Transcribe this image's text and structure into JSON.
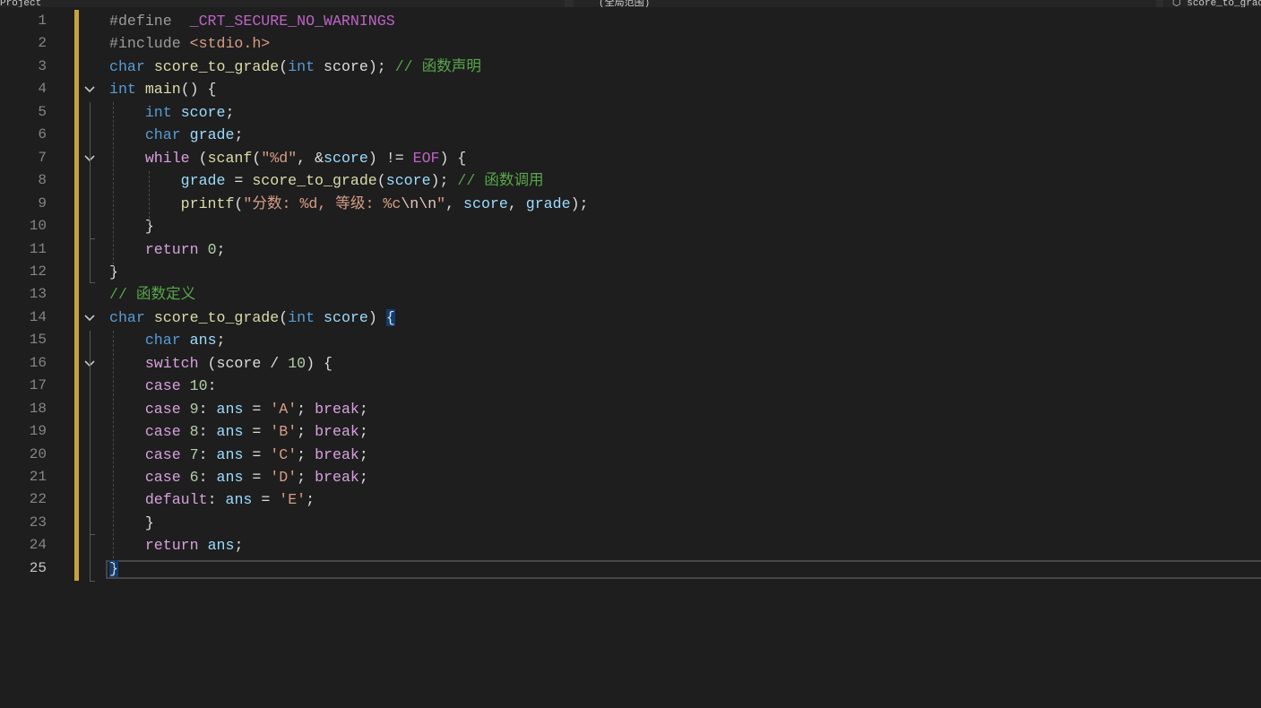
{
  "tabs": {
    "left": "Project",
    "middle": "(全局范围)",
    "right": "score_to_grade"
  },
  "colors": {
    "background": "#1e1e1e",
    "keyword": "#569cd6",
    "control": "#d8a0df",
    "function": "#dcdcaa",
    "variable": "#9cdcfe",
    "string": "#d69d85",
    "number": "#b5cea8",
    "comment": "#57a64a",
    "macro": "#bd63c5",
    "change_marker": "#c8a43a"
  },
  "editor": {
    "current_line": 25,
    "lines": [
      {
        "n": "1",
        "t": [
          [
            "pp",
            "#define"
          ],
          [
            "plain",
            "  "
          ],
          [
            "mac",
            "_CRT_SECURE_NO_WARNINGS"
          ]
        ]
      },
      {
        "n": "2",
        "t": [
          [
            "pp",
            "#include "
          ],
          [
            "inc",
            "<stdio.h>"
          ]
        ]
      },
      {
        "n": "3",
        "t": [
          [
            "kw",
            "char"
          ],
          [
            "plain",
            " "
          ],
          [
            "fn",
            "score_to_grade"
          ],
          [
            "plain",
            "("
          ],
          [
            "kw",
            "int"
          ],
          [
            "plain",
            " score); "
          ],
          [
            "cm",
            "// 函数声明"
          ]
        ]
      },
      {
        "n": "4",
        "t": [
          [
            "kw",
            "int"
          ],
          [
            "plain",
            " "
          ],
          [
            "fn",
            "main"
          ],
          [
            "plain",
            "() {"
          ]
        ]
      },
      {
        "n": "5",
        "t": [
          [
            "plain",
            "    "
          ],
          [
            "kw",
            "int"
          ],
          [
            "plain",
            " "
          ],
          [
            "var",
            "score"
          ],
          [
            "plain",
            ";"
          ]
        ]
      },
      {
        "n": "6",
        "t": [
          [
            "plain",
            "    "
          ],
          [
            "kw",
            "char"
          ],
          [
            "plain",
            " "
          ],
          [
            "var",
            "grade"
          ],
          [
            "plain",
            ";"
          ]
        ]
      },
      {
        "n": "7",
        "t": [
          [
            "plain",
            "    "
          ],
          [
            "ctl",
            "while"
          ],
          [
            "plain",
            " ("
          ],
          [
            "fn",
            "scanf"
          ],
          [
            "plain",
            "("
          ],
          [
            "str",
            "\"%d\""
          ],
          [
            "plain",
            ", &"
          ],
          [
            "var",
            "score"
          ],
          [
            "plain",
            ") != "
          ],
          [
            "mac",
            "EOF"
          ],
          [
            "plain",
            ") {"
          ]
        ]
      },
      {
        "n": "8",
        "t": [
          [
            "plain",
            "        "
          ],
          [
            "var",
            "grade"
          ],
          [
            "plain",
            " = "
          ],
          [
            "fn",
            "score_to_grade"
          ],
          [
            "plain",
            "("
          ],
          [
            "var",
            "score"
          ],
          [
            "plain",
            "); "
          ],
          [
            "cm",
            "// 函数调用"
          ]
        ]
      },
      {
        "n": "9",
        "t": [
          [
            "plain",
            "        "
          ],
          [
            "fn",
            "printf"
          ],
          [
            "plain",
            "("
          ],
          [
            "str",
            "\"分数: %d, 等级: %c"
          ],
          [
            "esc",
            "\\n\\n"
          ],
          [
            "str",
            "\""
          ],
          [
            "plain",
            ", "
          ],
          [
            "var",
            "score"
          ],
          [
            "plain",
            ", "
          ],
          [
            "var",
            "grade"
          ],
          [
            "plain",
            ");"
          ]
        ]
      },
      {
        "n": "10",
        "t": [
          [
            "plain",
            "    }"
          ]
        ]
      },
      {
        "n": "11",
        "t": [
          [
            "plain",
            "    "
          ],
          [
            "ctl",
            "return"
          ],
          [
            "plain",
            " "
          ],
          [
            "num",
            "0"
          ],
          [
            "plain",
            ";"
          ]
        ]
      },
      {
        "n": "12",
        "t": [
          [
            "plain",
            "}"
          ]
        ]
      },
      {
        "n": "13",
        "t": [
          [
            "cm",
            "// 函数定义"
          ]
        ]
      },
      {
        "n": "14",
        "t": [
          [
            "kw",
            "char"
          ],
          [
            "plain",
            " "
          ],
          [
            "fn",
            "score_to_grade"
          ],
          [
            "plain",
            "("
          ],
          [
            "kw",
            "int"
          ],
          [
            "plain",
            " "
          ],
          [
            "var",
            "score"
          ],
          [
            "plain",
            ") "
          ],
          [
            "brace",
            "{"
          ]
        ]
      },
      {
        "n": "15",
        "t": [
          [
            "plain",
            "    "
          ],
          [
            "kw",
            "char"
          ],
          [
            "plain",
            " "
          ],
          [
            "var",
            "ans"
          ],
          [
            "plain",
            ";"
          ]
        ]
      },
      {
        "n": "16",
        "t": [
          [
            "plain",
            "    "
          ],
          [
            "ctl",
            "switch"
          ],
          [
            "plain",
            " (score / "
          ],
          [
            "num",
            "10"
          ],
          [
            "plain",
            ") {"
          ]
        ]
      },
      {
        "n": "17",
        "t": [
          [
            "plain",
            "    "
          ],
          [
            "ctl",
            "case"
          ],
          [
            "plain",
            " "
          ],
          [
            "num",
            "10"
          ],
          [
            "plain",
            ":"
          ]
        ]
      },
      {
        "n": "18",
        "t": [
          [
            "plain",
            "    "
          ],
          [
            "ctl",
            "case"
          ],
          [
            "plain",
            " "
          ],
          [
            "num",
            "9"
          ],
          [
            "plain",
            ": "
          ],
          [
            "var",
            "ans"
          ],
          [
            "plain",
            " = "
          ],
          [
            "str",
            "'A'"
          ],
          [
            "plain",
            "; "
          ],
          [
            "ctl",
            "break"
          ],
          [
            "plain",
            ";"
          ]
        ]
      },
      {
        "n": "19",
        "t": [
          [
            "plain",
            "    "
          ],
          [
            "ctl",
            "case"
          ],
          [
            "plain",
            " "
          ],
          [
            "num",
            "8"
          ],
          [
            "plain",
            ": "
          ],
          [
            "var",
            "ans"
          ],
          [
            "plain",
            " = "
          ],
          [
            "str",
            "'B'"
          ],
          [
            "plain",
            "; "
          ],
          [
            "ctl",
            "break"
          ],
          [
            "plain",
            ";"
          ]
        ]
      },
      {
        "n": "20",
        "t": [
          [
            "plain",
            "    "
          ],
          [
            "ctl",
            "case"
          ],
          [
            "plain",
            " "
          ],
          [
            "num",
            "7"
          ],
          [
            "plain",
            ": "
          ],
          [
            "var",
            "ans"
          ],
          [
            "plain",
            " = "
          ],
          [
            "str",
            "'C'"
          ],
          [
            "plain",
            "; "
          ],
          [
            "ctl",
            "break"
          ],
          [
            "plain",
            ";"
          ]
        ]
      },
      {
        "n": "21",
        "t": [
          [
            "plain",
            "    "
          ],
          [
            "ctl",
            "case"
          ],
          [
            "plain",
            " "
          ],
          [
            "num",
            "6"
          ],
          [
            "plain",
            ": "
          ],
          [
            "var",
            "ans"
          ],
          [
            "plain",
            " = "
          ],
          [
            "str",
            "'D'"
          ],
          [
            "plain",
            "; "
          ],
          [
            "ctl",
            "break"
          ],
          [
            "plain",
            ";"
          ]
        ]
      },
      {
        "n": "22",
        "t": [
          [
            "plain",
            "    "
          ],
          [
            "ctl",
            "default"
          ],
          [
            "plain",
            ": "
          ],
          [
            "var",
            "ans"
          ],
          [
            "plain",
            " = "
          ],
          [
            "str",
            "'E'"
          ],
          [
            "plain",
            ";"
          ]
        ]
      },
      {
        "n": "23",
        "t": [
          [
            "plain",
            "    }"
          ]
        ]
      },
      {
        "n": "24",
        "t": [
          [
            "plain",
            "    "
          ],
          [
            "ctl",
            "return"
          ],
          [
            "plain",
            " "
          ],
          [
            "var",
            "ans"
          ],
          [
            "plain",
            ";"
          ]
        ]
      },
      {
        "n": "25",
        "t": [
          [
            "brace",
            "}"
          ]
        ]
      }
    ],
    "fold_lines": [
      "4",
      "7",
      "14",
      "16"
    ]
  }
}
